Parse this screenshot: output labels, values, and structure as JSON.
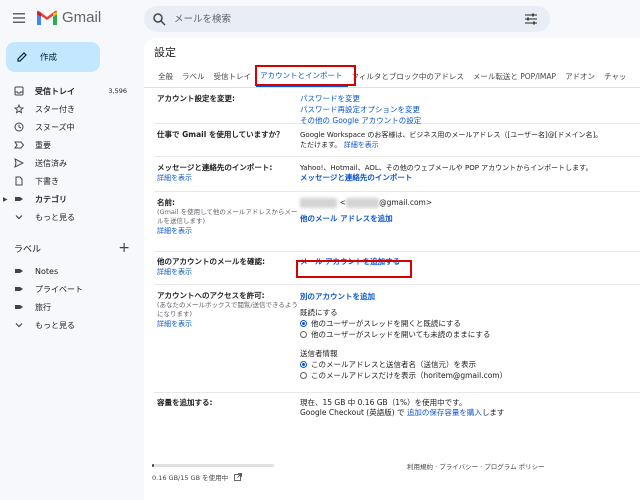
{
  "app": {
    "name": "Gmail",
    "accent": "#0b57d0",
    "highlight": "#d50000"
  },
  "search": {
    "placeholder": "メールを検索"
  },
  "compose": {
    "label": "作成"
  },
  "nav": [
    {
      "label": "受信トレイ",
      "count": "3,596",
      "bold": true,
      "icon": "inbox-icon"
    },
    {
      "label": "スター付き",
      "icon": "star-icon"
    },
    {
      "label": "スヌーズ中",
      "icon": "clock-icon"
    },
    {
      "label": "重要",
      "icon": "important-icon"
    },
    {
      "label": "送信済み",
      "icon": "send-icon"
    },
    {
      "label": "下書き",
      "icon": "draft-icon"
    },
    {
      "label": "カテゴリ",
      "bold": true,
      "icon": "label-icon"
    },
    {
      "label": "もっと見る",
      "icon": "chevron-down-icon"
    }
  ],
  "labels": {
    "heading": "ラベル",
    "items": [
      {
        "label": "Notes"
      },
      {
        "label": "プライベート"
      },
      {
        "label": "旅行"
      },
      {
        "label": "もっと見る"
      }
    ]
  },
  "settings": {
    "title": "設定",
    "tabs": [
      "全般",
      "ラベル",
      "受信トレイ",
      "アカウントとインポート",
      "フィルタとブロック中のアドレス",
      "メール転送と POP/IMAP",
      "アドオン",
      "チャッ"
    ],
    "active_tab": "アカウントとインポート",
    "rows": {
      "account": {
        "label": "アカウント設定を変更:",
        "links": [
          "パスワードを変更",
          "パスワード再設定オプションを変更",
          "その他の Google アカウントの設定"
        ]
      },
      "work": {
        "label": "仕事で Gmail を使用していますか？",
        "text": "Google Workspace のお客様は、ビジネス用のメールアドレス（[ユーザー名]@[ドメイン名]。",
        "text2": "ただけます。",
        "link": "詳細を表示"
      },
      "import": {
        "label": "メッセージと連絡先のインポート:",
        "detail": "詳細を表示",
        "text": "Yahoo!、Hotmail、AOL、その他のウェブメールや POP アカウントからインポートします。",
        "link": "メッセージと連絡先のインポート"
      },
      "name": {
        "label": "名前:",
        "sub": "(Gmail を使用して他のメールアドレスからメールを送信します)",
        "detail": "詳細を表示",
        "email_suffix": "@gmail.com>",
        "link": "他のメール アドレスを追加"
      },
      "check": {
        "label": "他のアカウントのメールを確認:",
        "detail": "詳細を表示",
        "link": "メール アカウントを追加する"
      },
      "access": {
        "label": "アカウントへのアクセスを許可:",
        "sub": "(あなたのメールボックスで閲覧/送信できるようになります)",
        "detail": "詳細を表示",
        "link": "別のアカウントを追加",
        "read_heading": "既読にする",
        "read_opt1": "他のユーザーがスレッドを開くと既読にする",
        "read_opt2": "他のユーザーがスレッドを開いても未読のままにする",
        "sender_heading": "送信者情報",
        "sender_opt1": "このメールアドレスと送信者名（送信元）を表示",
        "sender_opt2": "このメールアドレスだけを表示（horitem@gmail.com）"
      },
      "storage": {
        "label": "容量を追加する:",
        "text": "現在、15 GB 中 0.16 GB（1%）を使用中です。",
        "text2": "Google Checkout (英語版) で",
        "link": "追加の保存容量を購入",
        "text3": "します"
      }
    }
  },
  "footer": {
    "storage_text": "0.16 GB/15 GB を使用中",
    "storage_fraction": 0.011,
    "links": "利用規約 · プライバシー · プログラム ポリシー"
  }
}
